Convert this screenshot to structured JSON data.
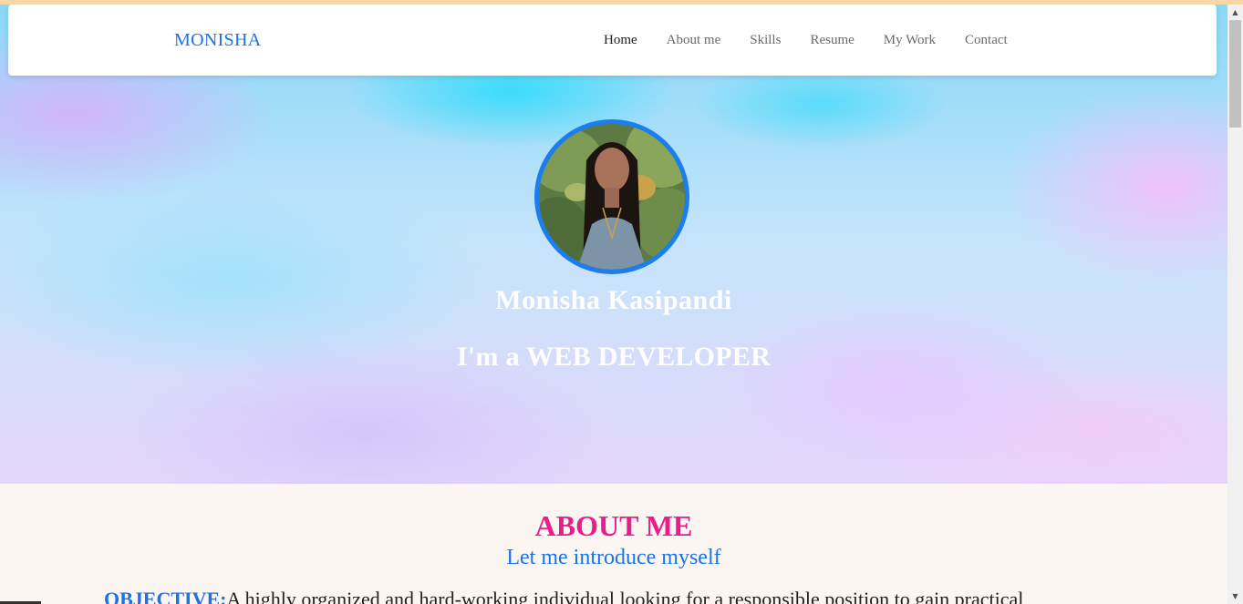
{
  "navbar": {
    "brand": "MONISHA",
    "links": [
      {
        "label": "Home",
        "active": true
      },
      {
        "label": "About me",
        "active": false
      },
      {
        "label": "Skills",
        "active": false
      },
      {
        "label": "Resume",
        "active": false
      },
      {
        "label": "My Work",
        "active": false
      },
      {
        "label": "Contact",
        "active": false
      }
    ]
  },
  "hero": {
    "name": "Monisha Kasipandi",
    "role": "I'm a WEB DEVELOPER",
    "avatar_icon": "profile-photo"
  },
  "about": {
    "title": "ABOUT ME",
    "subtitle": "Let me introduce myself",
    "objective_label": "OBJECTIVE:",
    "objective_text": "A highly organized and hard-working individual looking for a responsible position to gain practical"
  },
  "colors": {
    "brand": "#1a73e8",
    "accent_pink": "#ec1c8c",
    "avatar_border": "#1a7ef0",
    "about_bg": "#fbf6f2"
  },
  "scrollbar": {
    "up_icon": "scroll-up-arrow-icon",
    "down_icon": "scroll-down-arrow-icon"
  }
}
